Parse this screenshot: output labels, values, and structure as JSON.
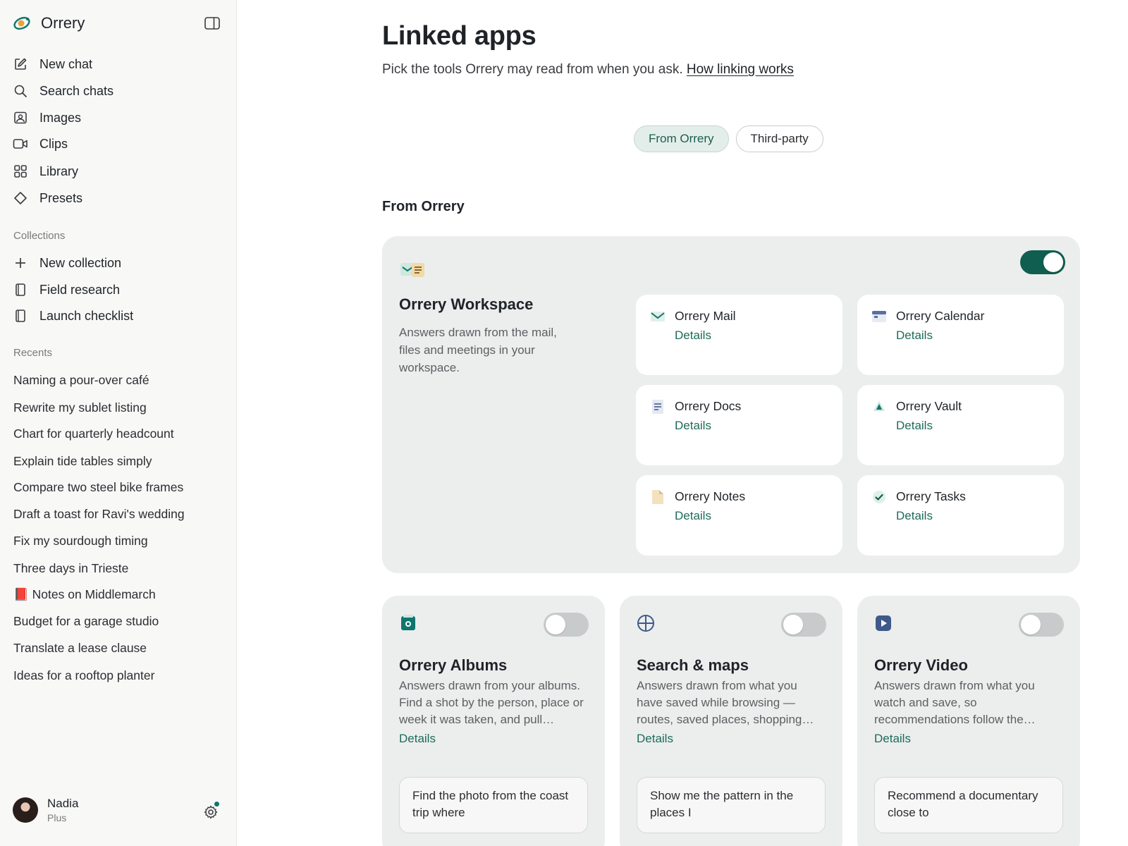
{
  "brand": {
    "name": "Orrery"
  },
  "nav": [
    {
      "label": "New chat",
      "icon": "pencil-square-icon"
    },
    {
      "label": "Search chats",
      "icon": "search-icon"
    },
    {
      "label": "Images",
      "icon": "image-icon"
    },
    {
      "label": "Clips",
      "icon": "video-icon"
    },
    {
      "label": "Library",
      "icon": "grid-icon"
    },
    {
      "label": "Presets",
      "icon": "diamond-icon"
    }
  ],
  "collections": {
    "label": "Collections",
    "items": [
      {
        "label": "New collection",
        "icon": "plus-icon"
      },
      {
        "label": "Field research",
        "icon": "notebook-icon"
      },
      {
        "label": "Launch checklist",
        "icon": "notebook-icon"
      }
    ]
  },
  "recents": {
    "label": "Recents",
    "items": [
      "Naming a pour-over café",
      "Rewrite my sublet listing",
      "Chart for quarterly headcount",
      "Explain tide tables simply",
      "Compare two steel bike frames",
      "Draft a toast for Ravi's wedding",
      "Fix my sourdough timing",
      "Three days in Trieste",
      "📕 Notes on Middlemarch",
      "Budget for a garage studio",
      "Translate a lease clause",
      "Ideas for a rooftop planter"
    ]
  },
  "user": {
    "name": "Nadia",
    "plan": "Plus"
  },
  "page": {
    "title": "Linked apps",
    "subtitle": "Pick the tools Orrery may read from when you ask.",
    "subtitle_link": "How linking works"
  },
  "tabs": [
    {
      "label": "From Orrery",
      "active": true
    },
    {
      "label": "Third-party",
      "active": false
    }
  ],
  "section_title": "From Orrery",
  "workspace": {
    "title": "Orrery Workspace",
    "description": "Answers drawn from the mail, files and meetings in your workspace.",
    "enabled": true,
    "apps": [
      {
        "name": "Orrery Mail",
        "details": "Details",
        "icon": "mail-icon"
      },
      {
        "name": "Orrery Calendar",
        "details": "Details",
        "icon": "calendar-icon"
      },
      {
        "name": "Orrery Docs",
        "details": "Details",
        "icon": "doc-icon"
      },
      {
        "name": "Orrery Vault",
        "details": "Details",
        "icon": "vault-triangle-icon"
      },
      {
        "name": "Orrery Notes",
        "details": "Details",
        "icon": "note-icon"
      },
      {
        "name": "Orrery Tasks",
        "details": "Details",
        "icon": "check-icon"
      }
    ]
  },
  "cards": [
    {
      "title": "Orrery Albums",
      "description": "Answers drawn from your albums. Find a shot by the person, place or week it was taken, and pull…",
      "details": "Details",
      "enabled": false,
      "icon": "albums-icon",
      "prompt": "Find the photo from the coast trip where"
    },
    {
      "title": "Search & maps",
      "description": "Answers drawn from what you have saved while browsing — routes, saved places, shopping…",
      "details": "Details",
      "enabled": false,
      "icon": "globe-icon",
      "prompt": "Show me the pattern in the places I"
    },
    {
      "title": "Orrery Video",
      "description": "Answers drawn from what you watch and save, so recommendations follow the…",
      "details": "Details",
      "enabled": false,
      "icon": "play-icon",
      "prompt": "Recommend a documentary close to"
    }
  ]
}
